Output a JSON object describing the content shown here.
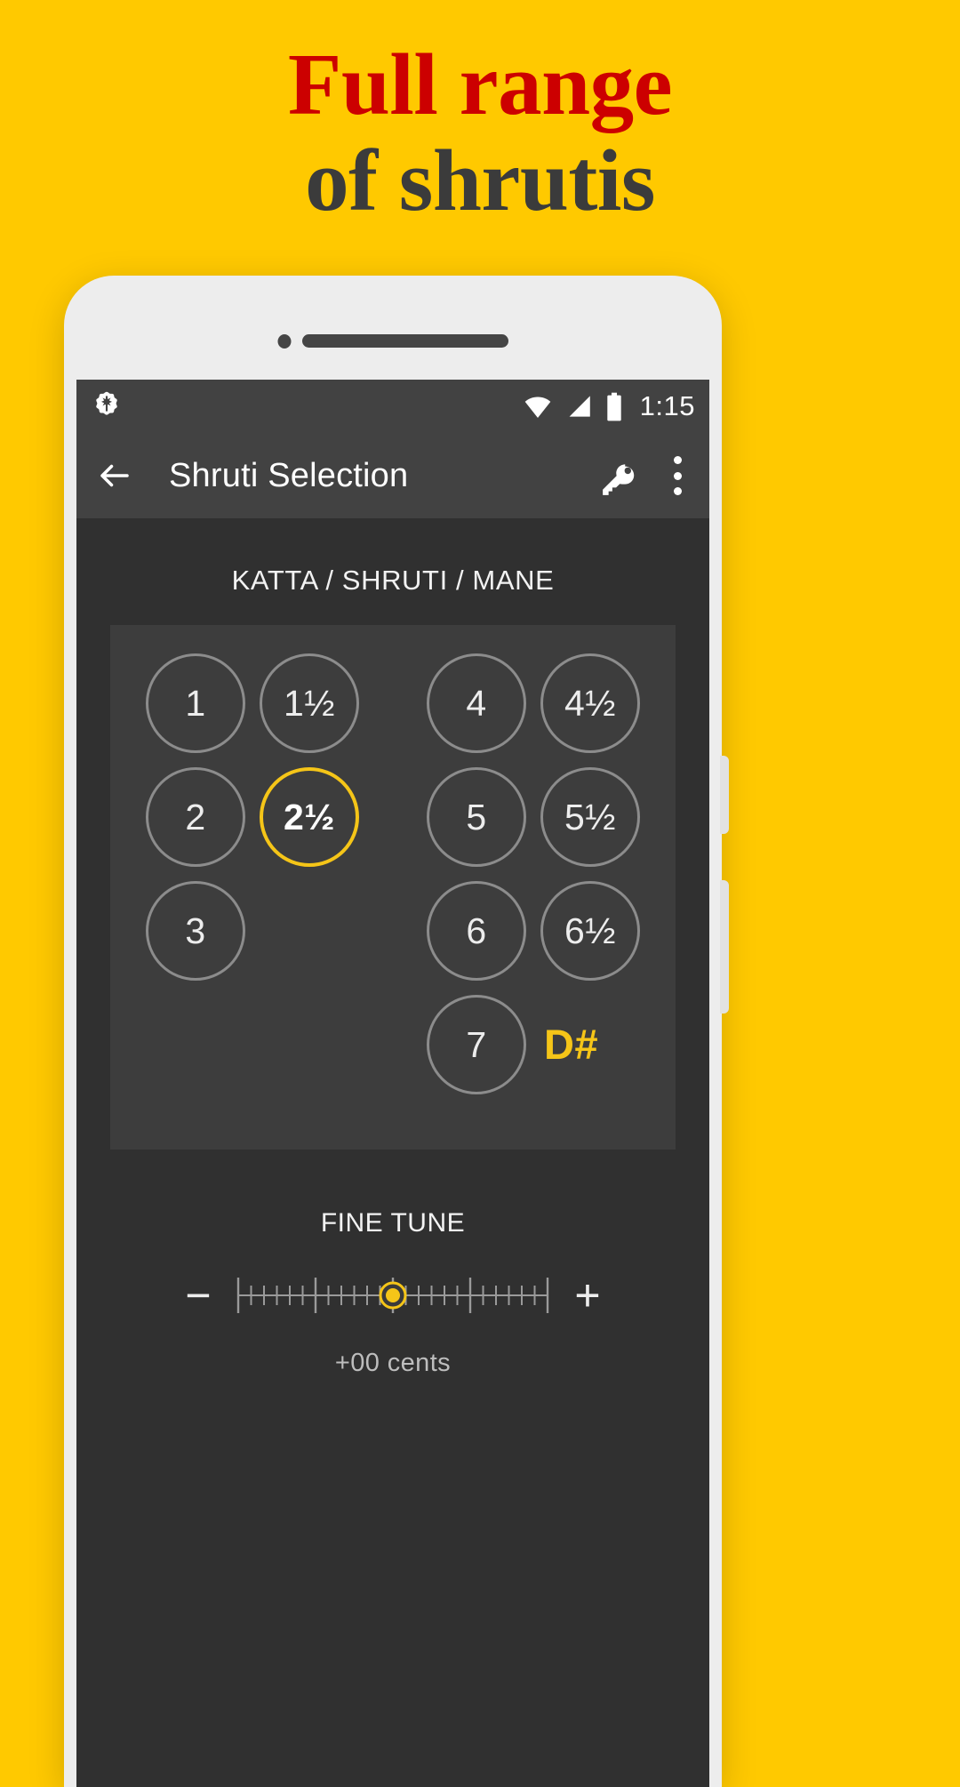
{
  "promo": {
    "line1": "Full range",
    "line2": "of shrutis",
    "line1_color": "#CC0000",
    "line2_color": "#3B3B3B",
    "background_color": "#FFC900"
  },
  "statusbar": {
    "icons": [
      "settings-asterisk-icon",
      "wifi-icon",
      "cell-signal-icon",
      "battery-icon"
    ],
    "time": "1:15"
  },
  "appbar": {
    "back_label": "back-arrow",
    "title": "Shruti Selection",
    "key_action": "key",
    "overflow_action": "more-options"
  },
  "main": {
    "section_label": "KATTA / SHRUTI / MANE",
    "note": "D#",
    "accent_color": "#F5C518",
    "shrutis": [
      {
        "label": "1",
        "selected": false,
        "col": 0,
        "row": 0
      },
      {
        "label": "1½",
        "selected": false,
        "col": 1,
        "row": 0
      },
      {
        "label": "4",
        "selected": false,
        "col": 2,
        "row": 0
      },
      {
        "label": "4½",
        "selected": false,
        "col": 3,
        "row": 0
      },
      {
        "label": "2",
        "selected": false,
        "col": 0,
        "row": 1
      },
      {
        "label": "2½",
        "selected": true,
        "col": 1,
        "row": 1
      },
      {
        "label": "5",
        "selected": false,
        "col": 2,
        "row": 1
      },
      {
        "label": "5½",
        "selected": false,
        "col": 3,
        "row": 1
      },
      {
        "label": "3",
        "selected": false,
        "col": 0,
        "row": 2
      },
      {
        "label": "6",
        "selected": false,
        "col": 2,
        "row": 2
      },
      {
        "label": "6½",
        "selected": false,
        "col": 3,
        "row": 2
      },
      {
        "label": "7",
        "selected": false,
        "col": 2,
        "row": 3
      }
    ]
  },
  "finetune": {
    "label": "FINE TUNE",
    "minus_label": "−",
    "plus_label": "+",
    "value_text": "+00 cents",
    "slider_position_percent": 50,
    "ticks": 25
  }
}
